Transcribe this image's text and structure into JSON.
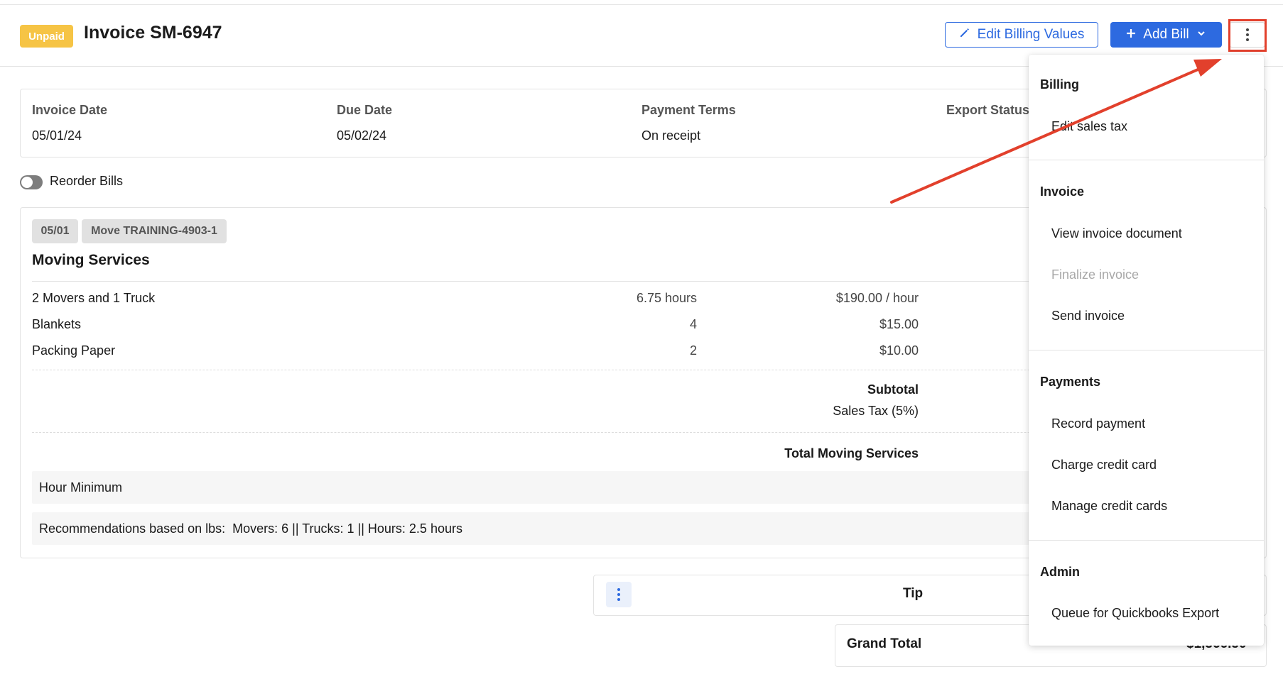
{
  "header": {
    "status_badge": "Unpaid",
    "title": "Invoice SM-6947",
    "edit_billing_label": "Edit Billing Values",
    "add_bill_label": "Add Bill"
  },
  "info": {
    "invoice_date_label": "Invoice Date",
    "invoice_date": "05/01/24",
    "due_date_label": "Due Date",
    "due_date": "05/02/24",
    "payment_terms_label": "Payment Terms",
    "payment_terms": "On receipt",
    "export_status_label": "Export Status"
  },
  "reorder_label": "Reorder Bills",
  "bill": {
    "date_tag": "05/01",
    "move_tag": "Move TRAINING-4903-1",
    "title": "Moving Services",
    "items": [
      {
        "name": "2 Movers and 1 Truck",
        "qty": "6.75 hours",
        "rate": "$190.00 / hour"
      },
      {
        "name": "Blankets",
        "qty": "4",
        "rate": "$15.00"
      },
      {
        "name": "Packing Paper",
        "qty": "2",
        "rate": "$10.00"
      }
    ],
    "subtotal_label": "Subtotal",
    "sales_tax_label": "Sales Tax (5%)",
    "total_label": "Total Moving Services",
    "hour_minimum_label": "Hour Minimum",
    "recommendation": "Recommendations based on lbs:  Movers: 6 || Trucks: 1 || Hours: 2.5 hours"
  },
  "tip_label": "Tip",
  "grand_total_label": "Grand Total",
  "grand_total_value": "$1,366.50",
  "menu": {
    "billing_heading": "Billing",
    "edit_sales_tax": "Edit sales tax",
    "invoice_heading": "Invoice",
    "view_invoice_document": "View invoice document",
    "finalize_invoice": "Finalize invoice",
    "send_invoice": "Send invoice",
    "payments_heading": "Payments",
    "record_payment": "Record payment",
    "charge_credit_card": "Charge credit card",
    "manage_credit_cards": "Manage credit cards",
    "admin_heading": "Admin",
    "queue_quickbooks": "Queue for Quickbooks Export"
  },
  "colors": {
    "primary": "#2d6ae0",
    "badge_unpaid": "#f6c445",
    "annotation_red": "#e2402c"
  }
}
